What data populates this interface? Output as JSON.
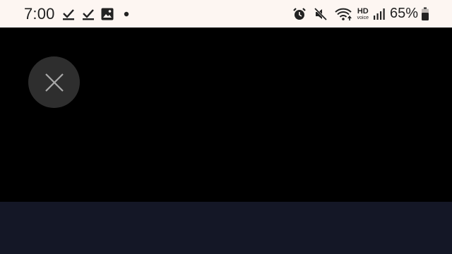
{
  "status_bar": {
    "time": "7:00",
    "left_icons": [
      "download-done-icon",
      "download-done-icon",
      "image-icon",
      "notification-dot-icon"
    ],
    "right_icons": [
      "alarm-icon",
      "mute-icon",
      "wifi-icon",
      "hd-voice-icon",
      "signal-icon",
      "battery-icon"
    ],
    "hd_label": "HD",
    "voice_label": "voice",
    "battery_percent": "65%"
  },
  "overlay": {
    "close_button_icon": "close-icon"
  },
  "colors": {
    "status_bar_bg": "#fdf6f2",
    "video_bg": "#000000",
    "close_button_bg": "#2e2e2e",
    "bottom_panel_bg": "#141726"
  }
}
